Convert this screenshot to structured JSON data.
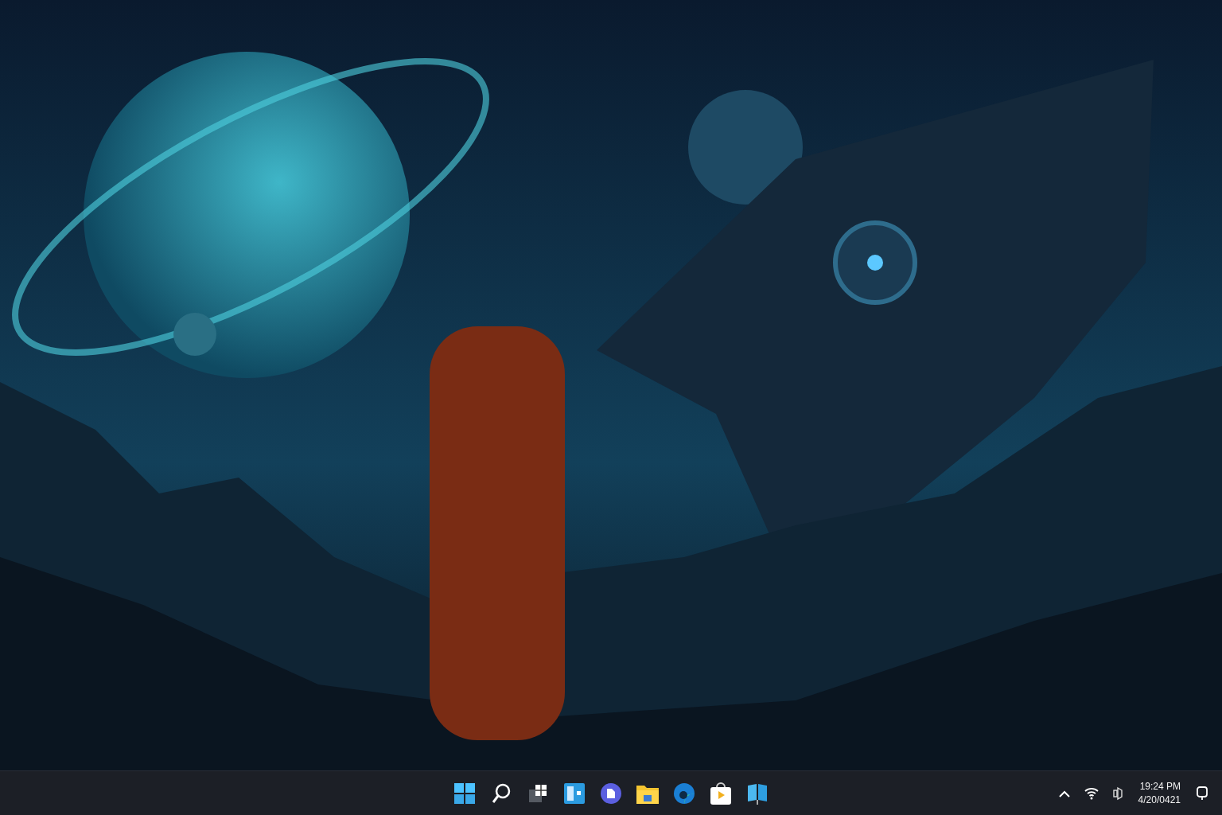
{
  "taskbar": {
    "clock": {
      "time": "19:24 PM",
      "date": "4/20/0421"
    }
  }
}
